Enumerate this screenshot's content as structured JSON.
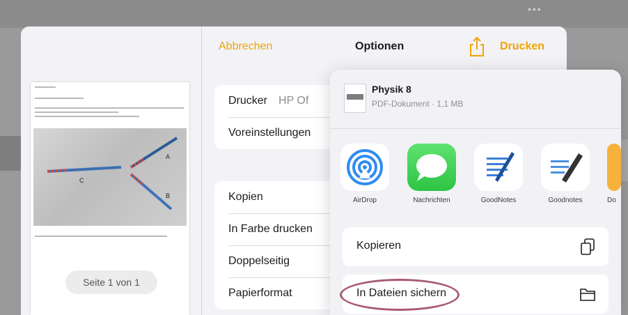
{
  "sheet": {
    "cancel_label": "Abbrechen",
    "title": "Optionen",
    "print_label": "Drucken",
    "accent": "#f0a500",
    "share_icon": "share-icon"
  },
  "preview": {
    "page_label": "Seite 1 von 1",
    "photo_labels": [
      "A",
      "B",
      "C"
    ]
  },
  "printer_group": [
    {
      "label": "Drucker",
      "value": "HP Of"
    },
    {
      "label": "Voreinstellungen",
      "value": ""
    }
  ],
  "settings_group": [
    {
      "label": "Kopien"
    },
    {
      "label": "In Farbe drucken"
    },
    {
      "label": "Doppelseitig"
    },
    {
      "label": "Papierformat"
    }
  ],
  "share": {
    "file_name": "Physik 8",
    "file_meta": "PDF-Dokument · 1,1 MB",
    "apps": [
      {
        "label": "AirDrop",
        "icon": "airdrop-icon"
      },
      {
        "label": "Nachrichten",
        "icon": "messages-icon"
      },
      {
        "label": "GoodNotes",
        "icon": "goodnotes-icon"
      },
      {
        "label": "Goodnotes",
        "icon": "goodnotes-new-icon"
      },
      {
        "label": "Do",
        "icon": "app-icon"
      }
    ],
    "actions": [
      {
        "label": "Kopieren",
        "icon": "copy-icon"
      },
      {
        "label": "In Dateien sichern",
        "icon": "folder-icon"
      }
    ]
  }
}
